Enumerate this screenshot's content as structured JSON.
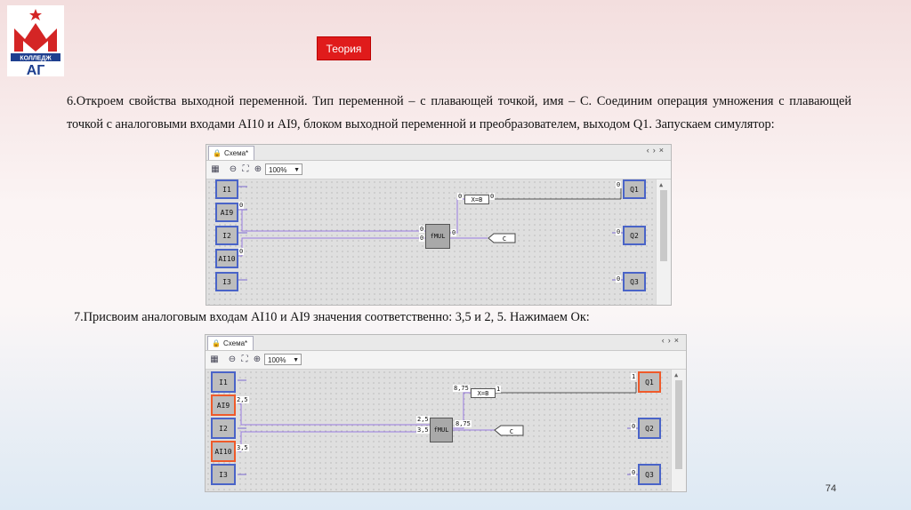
{
  "logo": {
    "text": "КОЛЛЕДЖ",
    "letters": "АГ",
    "colors": {
      "red": "#d42525",
      "blue": "#1e3f8f"
    }
  },
  "theory_button": "Теория",
  "paragraph1": "6.Откроем свойства выходной переменной. Тип переменной – с плавающей точкой, имя – С. Соединим операция умножения с плавающей точкой с аналоговыми входами AI10 и AI9, блоком выходной переменной и преобразователем, выходом Q1. Запускаем симулятор:",
  "paragraph2": "7.Присвоим аналоговым входам AI10 и AI9 значения соответственно: 3,5 и 2, 5. Нажимаем Ок:",
  "page_number": "74",
  "schema1": {
    "tab": "Схема*",
    "zoom": "100%",
    "inputs": [
      "I1",
      "AI9",
      "I2",
      "AI10",
      "I3"
    ],
    "outputs": [
      "Q1",
      "Q2",
      "Q3"
    ],
    "fmul": "fMUL",
    "xeqb": "X=B",
    "var": "C",
    "values": {
      "ai9": "0",
      "ai10": "0",
      "fmul_in1": "0",
      "fmul_in2": "0",
      "fmul_out": "0",
      "xeqb_in": "0",
      "xeqb_out": "0",
      "q1": "0",
      "q2": "0",
      "q3": "0"
    }
  },
  "schema2": {
    "tab": "Схема*",
    "zoom": "100%",
    "inputs": [
      "I1",
      "AI9",
      "I2",
      "AI10",
      "I3"
    ],
    "outputs": [
      "Q1",
      "Q2",
      "Q3"
    ],
    "fmul": "fMUL",
    "xeqb": "X=B",
    "var": "C",
    "values": {
      "ai9": "2,5",
      "ai10": "3,5",
      "fmul_in1": "2,5",
      "fmul_in2": "3,5",
      "fmul_out": "8,75",
      "xeqb_in": "8,75",
      "xeqb_out": "1",
      "q1": "1",
      "q2": "0",
      "q3": "0"
    }
  }
}
